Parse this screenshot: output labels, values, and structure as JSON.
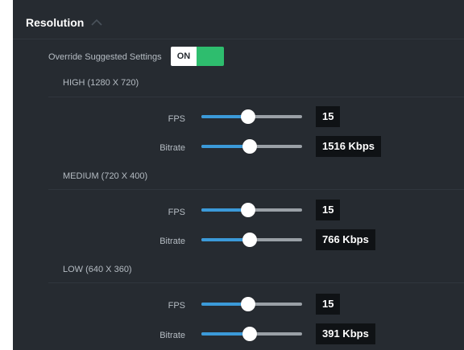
{
  "resolution": {
    "title": "Resolution"
  },
  "override": {
    "label": "Override Suggested Settings",
    "toggle_label": "ON"
  },
  "sections": [
    {
      "label": "HIGH (1280 X 720)",
      "rows": [
        {
          "label": "FPS",
          "value": "15",
          "level": 0.46
        },
        {
          "label": "Bitrate",
          "value": "1516 Kbps",
          "level": 0.48
        }
      ]
    },
    {
      "label": "MEDIUM (720 X 400)",
      "rows": [
        {
          "label": "FPS",
          "value": "15",
          "level": 0.46
        },
        {
          "label": "Bitrate",
          "value": "766 Kbps",
          "level": 0.48
        }
      ]
    },
    {
      "label": "LOW (640 X 360)",
      "rows": [
        {
          "label": "FPS",
          "value": "15",
          "level": 0.46
        },
        {
          "label": "Bitrate",
          "value": "391 Kbps",
          "level": 0.48
        }
      ]
    }
  ],
  "colors": {
    "panel_bg": "#262b31",
    "accent_blue": "#3b9ad9",
    "toggle_green": "#2ebd6e",
    "value_box_bg": "#0f1215"
  },
  "icons": {
    "collapse": "chevron-up-icon"
  }
}
